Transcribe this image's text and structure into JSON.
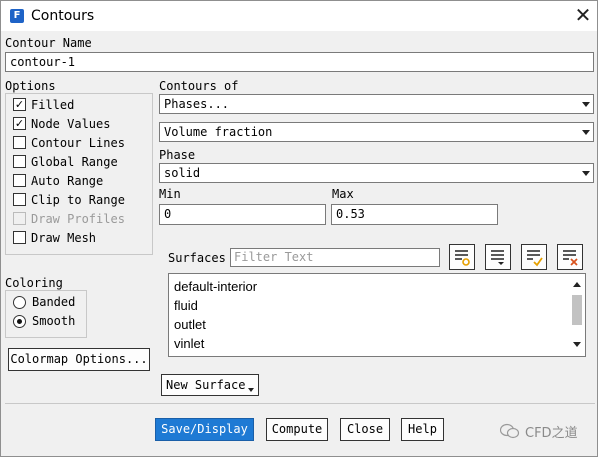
{
  "window": {
    "title": "Contours",
    "app_icon": "F"
  },
  "contour_name": {
    "label": "Contour Name",
    "value": "contour-1"
  },
  "options": {
    "label": "Options",
    "items": [
      {
        "label": "Filled",
        "checked": true,
        "disabled": false
      },
      {
        "label": "Node Values",
        "checked": true,
        "disabled": false
      },
      {
        "label": "Contour Lines",
        "checked": false,
        "disabled": false
      },
      {
        "label": "Global Range",
        "checked": false,
        "disabled": false
      },
      {
        "label": "Auto Range",
        "checked": false,
        "disabled": false
      },
      {
        "label": "Clip to Range",
        "checked": false,
        "disabled": false
      },
      {
        "label": "Draw Profiles",
        "checked": false,
        "disabled": true
      },
      {
        "label": "Draw Mesh",
        "checked": false,
        "disabled": false
      }
    ]
  },
  "coloring": {
    "label": "Coloring",
    "items": [
      {
        "label": "Banded",
        "selected": false
      },
      {
        "label": "Smooth",
        "selected": true
      }
    ]
  },
  "colormap_button": "Colormap Options...",
  "contours_of": {
    "label": "Contours of",
    "category": "Phases...",
    "variable": "Volume fraction"
  },
  "phase": {
    "label": "Phase",
    "value": "solid"
  },
  "min": {
    "label": "Min",
    "value": "0"
  },
  "max": {
    "label": "Max",
    "value": "0.53"
  },
  "surfaces": {
    "label": "Surfaces",
    "filter_placeholder": "Filter Text",
    "items": [
      "default-interior",
      "fluid",
      "outlet",
      "vinlet"
    ]
  },
  "new_surface_button": "New Surface",
  "buttons": {
    "save_display": "Save/Display",
    "compute": "Compute",
    "close": "Close",
    "help": "Help"
  },
  "watermark": "CFD之道",
  "colors": {
    "primary_button": "#1e7ad4",
    "app_icon": "#1e63c7",
    "check_accent": "#e6a000",
    "clear_accent": "#d9531e"
  }
}
